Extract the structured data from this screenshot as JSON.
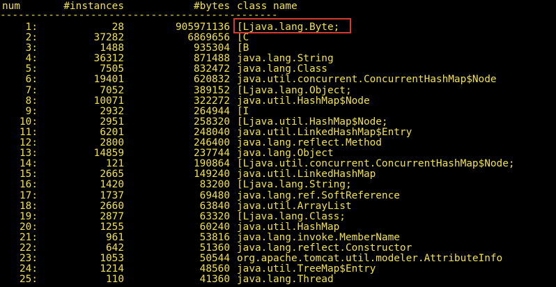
{
  "header": {
    "num": "num",
    "instances": "#instances",
    "bytes": "#bytes",
    "class_name": "class name"
  },
  "separator": "----------------------------------------------",
  "rows": [
    {
      "num": "1:",
      "instances": "28",
      "bytes": "905971136",
      "class_name": "[Ljava.lang.Byte;"
    },
    {
      "num": "2:",
      "instances": "37282",
      "bytes": "6869656",
      "class_name": "[C"
    },
    {
      "num": "3:",
      "instances": "1488",
      "bytes": "935304",
      "class_name": "[B"
    },
    {
      "num": "4:",
      "instances": "36312",
      "bytes": "871488",
      "class_name": "java.lang.String"
    },
    {
      "num": "5:",
      "instances": "7505",
      "bytes": "832472",
      "class_name": "java.lang.Class"
    },
    {
      "num": "6:",
      "instances": "19401",
      "bytes": "620832",
      "class_name": "java.util.concurrent.ConcurrentHashMap$Node"
    },
    {
      "num": "7:",
      "instances": "7052",
      "bytes": "389152",
      "class_name": "[Ljava.lang.Object;"
    },
    {
      "num": "8:",
      "instances": "10071",
      "bytes": "322272",
      "class_name": "java.util.HashMap$Node"
    },
    {
      "num": "9:",
      "instances": "2932",
      "bytes": "264944",
      "class_name": "[I"
    },
    {
      "num": "10:",
      "instances": "2951",
      "bytes": "258320",
      "class_name": "[Ljava.util.HashMap$Node;"
    },
    {
      "num": "11:",
      "instances": "6201",
      "bytes": "248040",
      "class_name": "java.util.LinkedHashMap$Entry"
    },
    {
      "num": "12:",
      "instances": "2800",
      "bytes": "246400",
      "class_name": "java.lang.reflect.Method"
    },
    {
      "num": "13:",
      "instances": "14859",
      "bytes": "237744",
      "class_name": "java.lang.Object"
    },
    {
      "num": "14:",
      "instances": "121",
      "bytes": "190864",
      "class_name": "[Ljava.util.concurrent.ConcurrentHashMap$Node;"
    },
    {
      "num": "15:",
      "instances": "2665",
      "bytes": "149240",
      "class_name": "java.util.LinkedHashMap"
    },
    {
      "num": "16:",
      "instances": "1420",
      "bytes": "83200",
      "class_name": "[Ljava.lang.String;"
    },
    {
      "num": "17:",
      "instances": "1737",
      "bytes": "69480",
      "class_name": "java.lang.ref.SoftReference"
    },
    {
      "num": "18:",
      "instances": "2660",
      "bytes": "63840",
      "class_name": "java.util.ArrayList"
    },
    {
      "num": "19:",
      "instances": "2877",
      "bytes": "63320",
      "class_name": "[Ljava.lang.Class;"
    },
    {
      "num": "20:",
      "instances": "1255",
      "bytes": "60240",
      "class_name": "java.util.HashMap"
    },
    {
      "num": "21:",
      "instances": "961",
      "bytes": "53816",
      "class_name": "java.lang.invoke.MemberName"
    },
    {
      "num": "22:",
      "instances": "642",
      "bytes": "51360",
      "class_name": "java.lang.reflect.Constructor"
    },
    {
      "num": "23:",
      "instances": "1053",
      "bytes": "50544",
      "class_name": "org.apache.tomcat.util.modeler.AttributeInfo"
    },
    {
      "num": "24:",
      "instances": "1214",
      "bytes": "48560",
      "class_name": "java.util.TreeMap$Entry"
    },
    {
      "num": "25:",
      "instances": "110",
      "bytes": "41360",
      "class_name": "java.lang.Thread"
    }
  ],
  "colors": {
    "background": "#000000",
    "text": "#f2e14a",
    "highlight_border": "#d43a2f"
  }
}
